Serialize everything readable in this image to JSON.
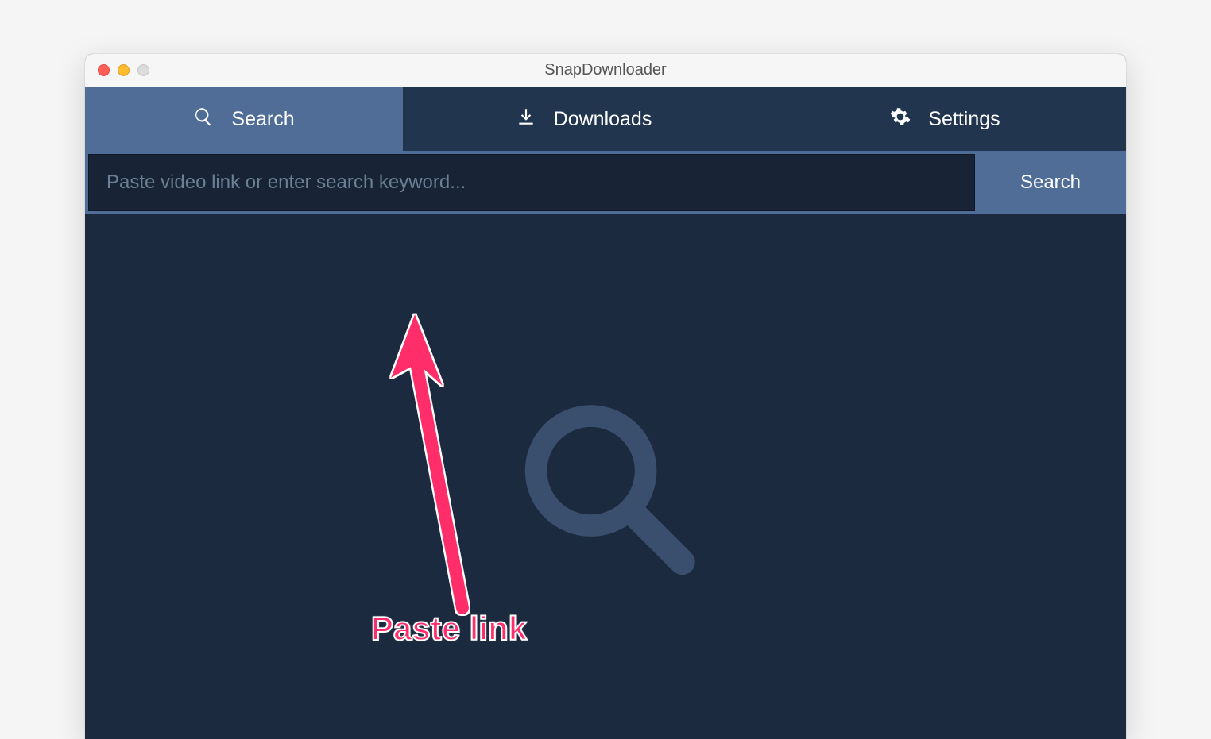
{
  "window": {
    "title": "SnapDownloader"
  },
  "tabs": {
    "search": {
      "label": "Search"
    },
    "downloads": {
      "label": "Downloads"
    },
    "settings": {
      "label": "Settings"
    }
  },
  "searchbar": {
    "placeholder": "Paste video link or enter search keyword...",
    "button_label": "Search"
  },
  "annotation": {
    "text": "Paste link"
  },
  "colors": {
    "accent": "#4f6d97",
    "bg_dark": "#1b2a3e",
    "tab_inactive": "#22354e",
    "input_bg": "#182436",
    "annotation": "#ff2d6b"
  }
}
